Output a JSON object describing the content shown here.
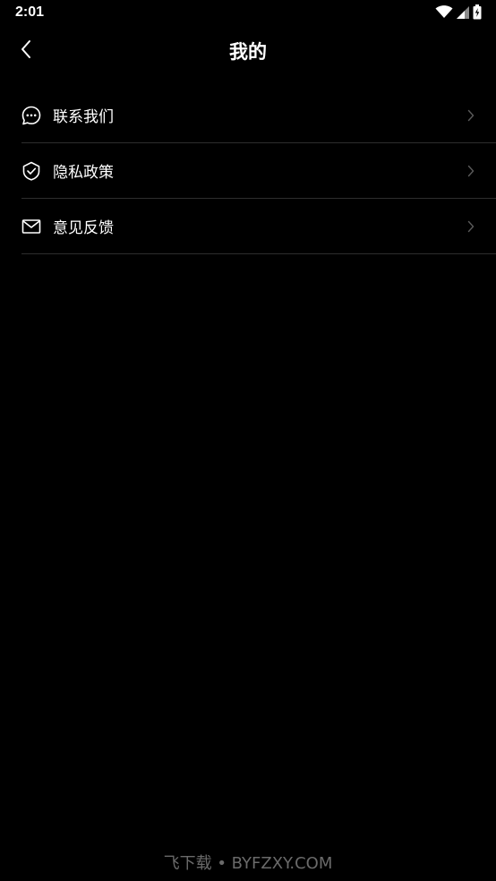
{
  "status_bar": {
    "time": "2:01",
    "icons": [
      "wifi-icon",
      "signal-icon",
      "battery-charging-icon"
    ]
  },
  "header": {
    "title": "我的",
    "back_icon": "chevron-left-icon"
  },
  "menu": {
    "items": [
      {
        "label": "联系我们",
        "icon": "chat-bubble-icon"
      },
      {
        "label": "隐私政策",
        "icon": "shield-check-icon"
      },
      {
        "label": "意见反馈",
        "icon": "mail-icon"
      }
    ],
    "chevron_icon": "chevron-right-icon"
  },
  "watermark": {
    "text": "飞下载 • BYFZXY.COM"
  },
  "colors": {
    "background": "#000000",
    "text": "#ffffff",
    "divider": "#2e2e2e",
    "chevron": "#5a5a5a",
    "watermark": "#6a6a6a"
  }
}
